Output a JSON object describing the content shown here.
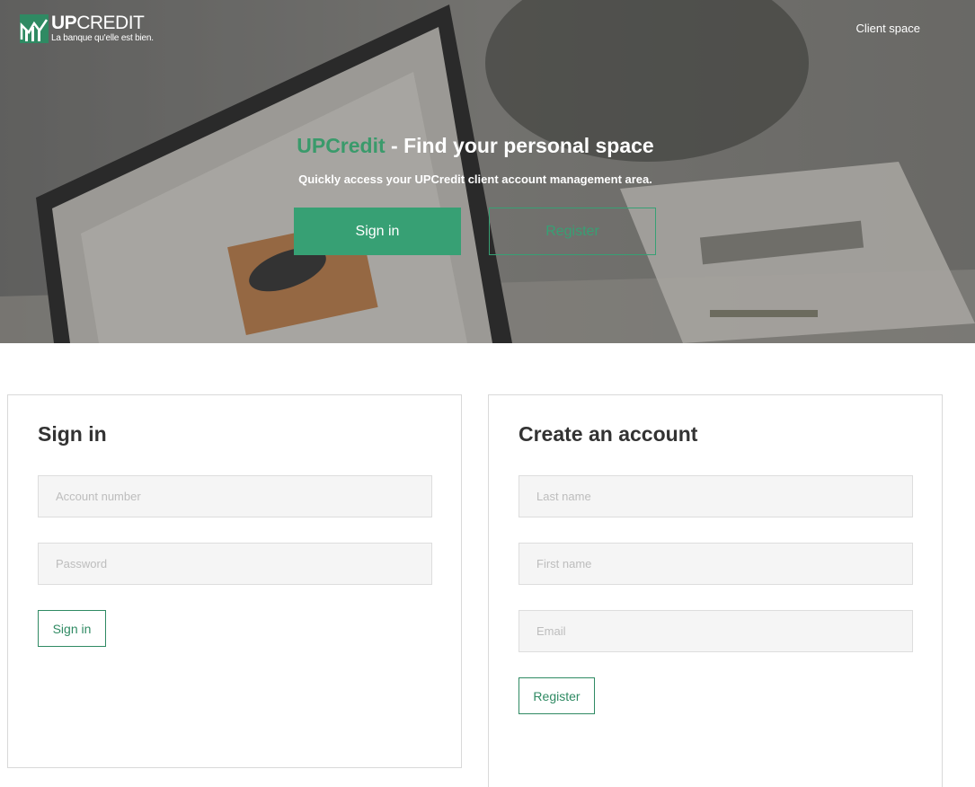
{
  "header": {
    "brand_bold": "UP",
    "brand_light": "CREDIT",
    "tagline": "La banque qu'elle est bien.",
    "client_space_link": "Client space"
  },
  "hero": {
    "title_accent": "UPCredit",
    "title_rest": " - Find your personal space",
    "subtitle": "Quickly access your UPCredit client account management area.",
    "signin_button": "Sign in",
    "register_button": "Register"
  },
  "signin_form": {
    "heading": "Sign in",
    "account_placeholder": "Account number",
    "password_placeholder": "Password",
    "submit_label": "Sign in"
  },
  "register_form": {
    "heading": "Create an account",
    "lastname_placeholder": "Last name",
    "firstname_placeholder": "First name",
    "email_placeholder": "Email",
    "submit_label": "Register"
  },
  "colors": {
    "accent": "#37a074",
    "accent_dark": "#2f8a63",
    "field_bg": "#f5f5f5",
    "card_border": "#d9d9d9"
  }
}
